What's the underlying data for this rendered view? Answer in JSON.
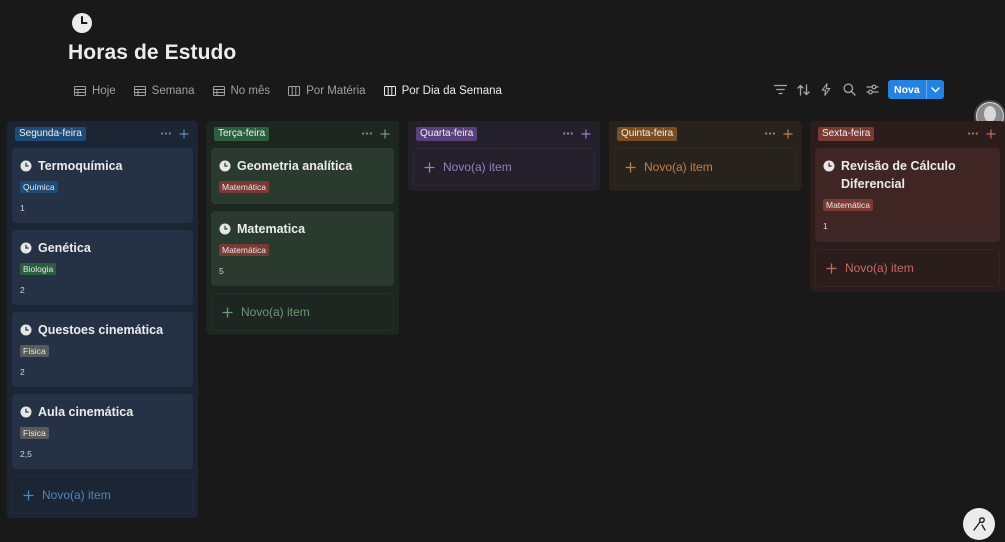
{
  "page": {
    "title": "Horas de Estudo",
    "icon": "clock-icon"
  },
  "tabs": [
    {
      "label": "Hoje",
      "icon": "table-icon"
    },
    {
      "label": "Semana",
      "icon": "table-icon"
    },
    {
      "label": "No mês",
      "icon": "table-icon"
    },
    {
      "label": "Por Matéria",
      "icon": "board-icon"
    },
    {
      "label": "Por Dia da Semana",
      "icon": "board-icon",
      "active": true
    }
  ],
  "toolbar": {
    "icons": [
      "filter-icon",
      "sort-icon",
      "lightning-icon",
      "search-icon",
      "settings-sliders-icon"
    ],
    "new_label": "Nova",
    "accent": "#2383e2"
  },
  "colors": {
    "tag_quimica": "#1f4b77",
    "tag_biologia": "#2b5e3f",
    "tag_fisica": "#5a5a5a",
    "tag_matematica": "#7a3a34"
  },
  "board": {
    "new_item_label": "Novo(a) item",
    "columns": [
      {
        "label": "Segunda-feira",
        "tag_color": "#1f4b77",
        "cards": [
          {
            "title": "Termoquímica",
            "tag": "Química",
            "value": "1"
          },
          {
            "title": "Genética",
            "tag": "Biologia",
            "value": "2"
          },
          {
            "title": "Questoes cinemática",
            "tag": "Física",
            "value": "2"
          },
          {
            "title": "Aula cinemática",
            "tag": "Física",
            "value": "2,5"
          }
        ]
      },
      {
        "label": "Terça-feira",
        "tag_color": "#2b5e3f",
        "cards": [
          {
            "title": "Geometria analítica",
            "tag": "Matemática",
            "value": ""
          },
          {
            "title": "Matematica",
            "tag": "Matemática",
            "value": "5"
          }
        ]
      },
      {
        "label": "Quarta-feira",
        "tag_color": "#5a3f7a",
        "cards": []
      },
      {
        "label": "Quinta-feira",
        "tag_color": "#7a4d22",
        "cards": []
      },
      {
        "label": "Sexta-feira",
        "tag_color": "#7a3a34",
        "cards": [
          {
            "title": "Revisão de Cálculo Diferencial",
            "tag": "Matemática",
            "value": "1"
          }
        ]
      }
    ]
  }
}
